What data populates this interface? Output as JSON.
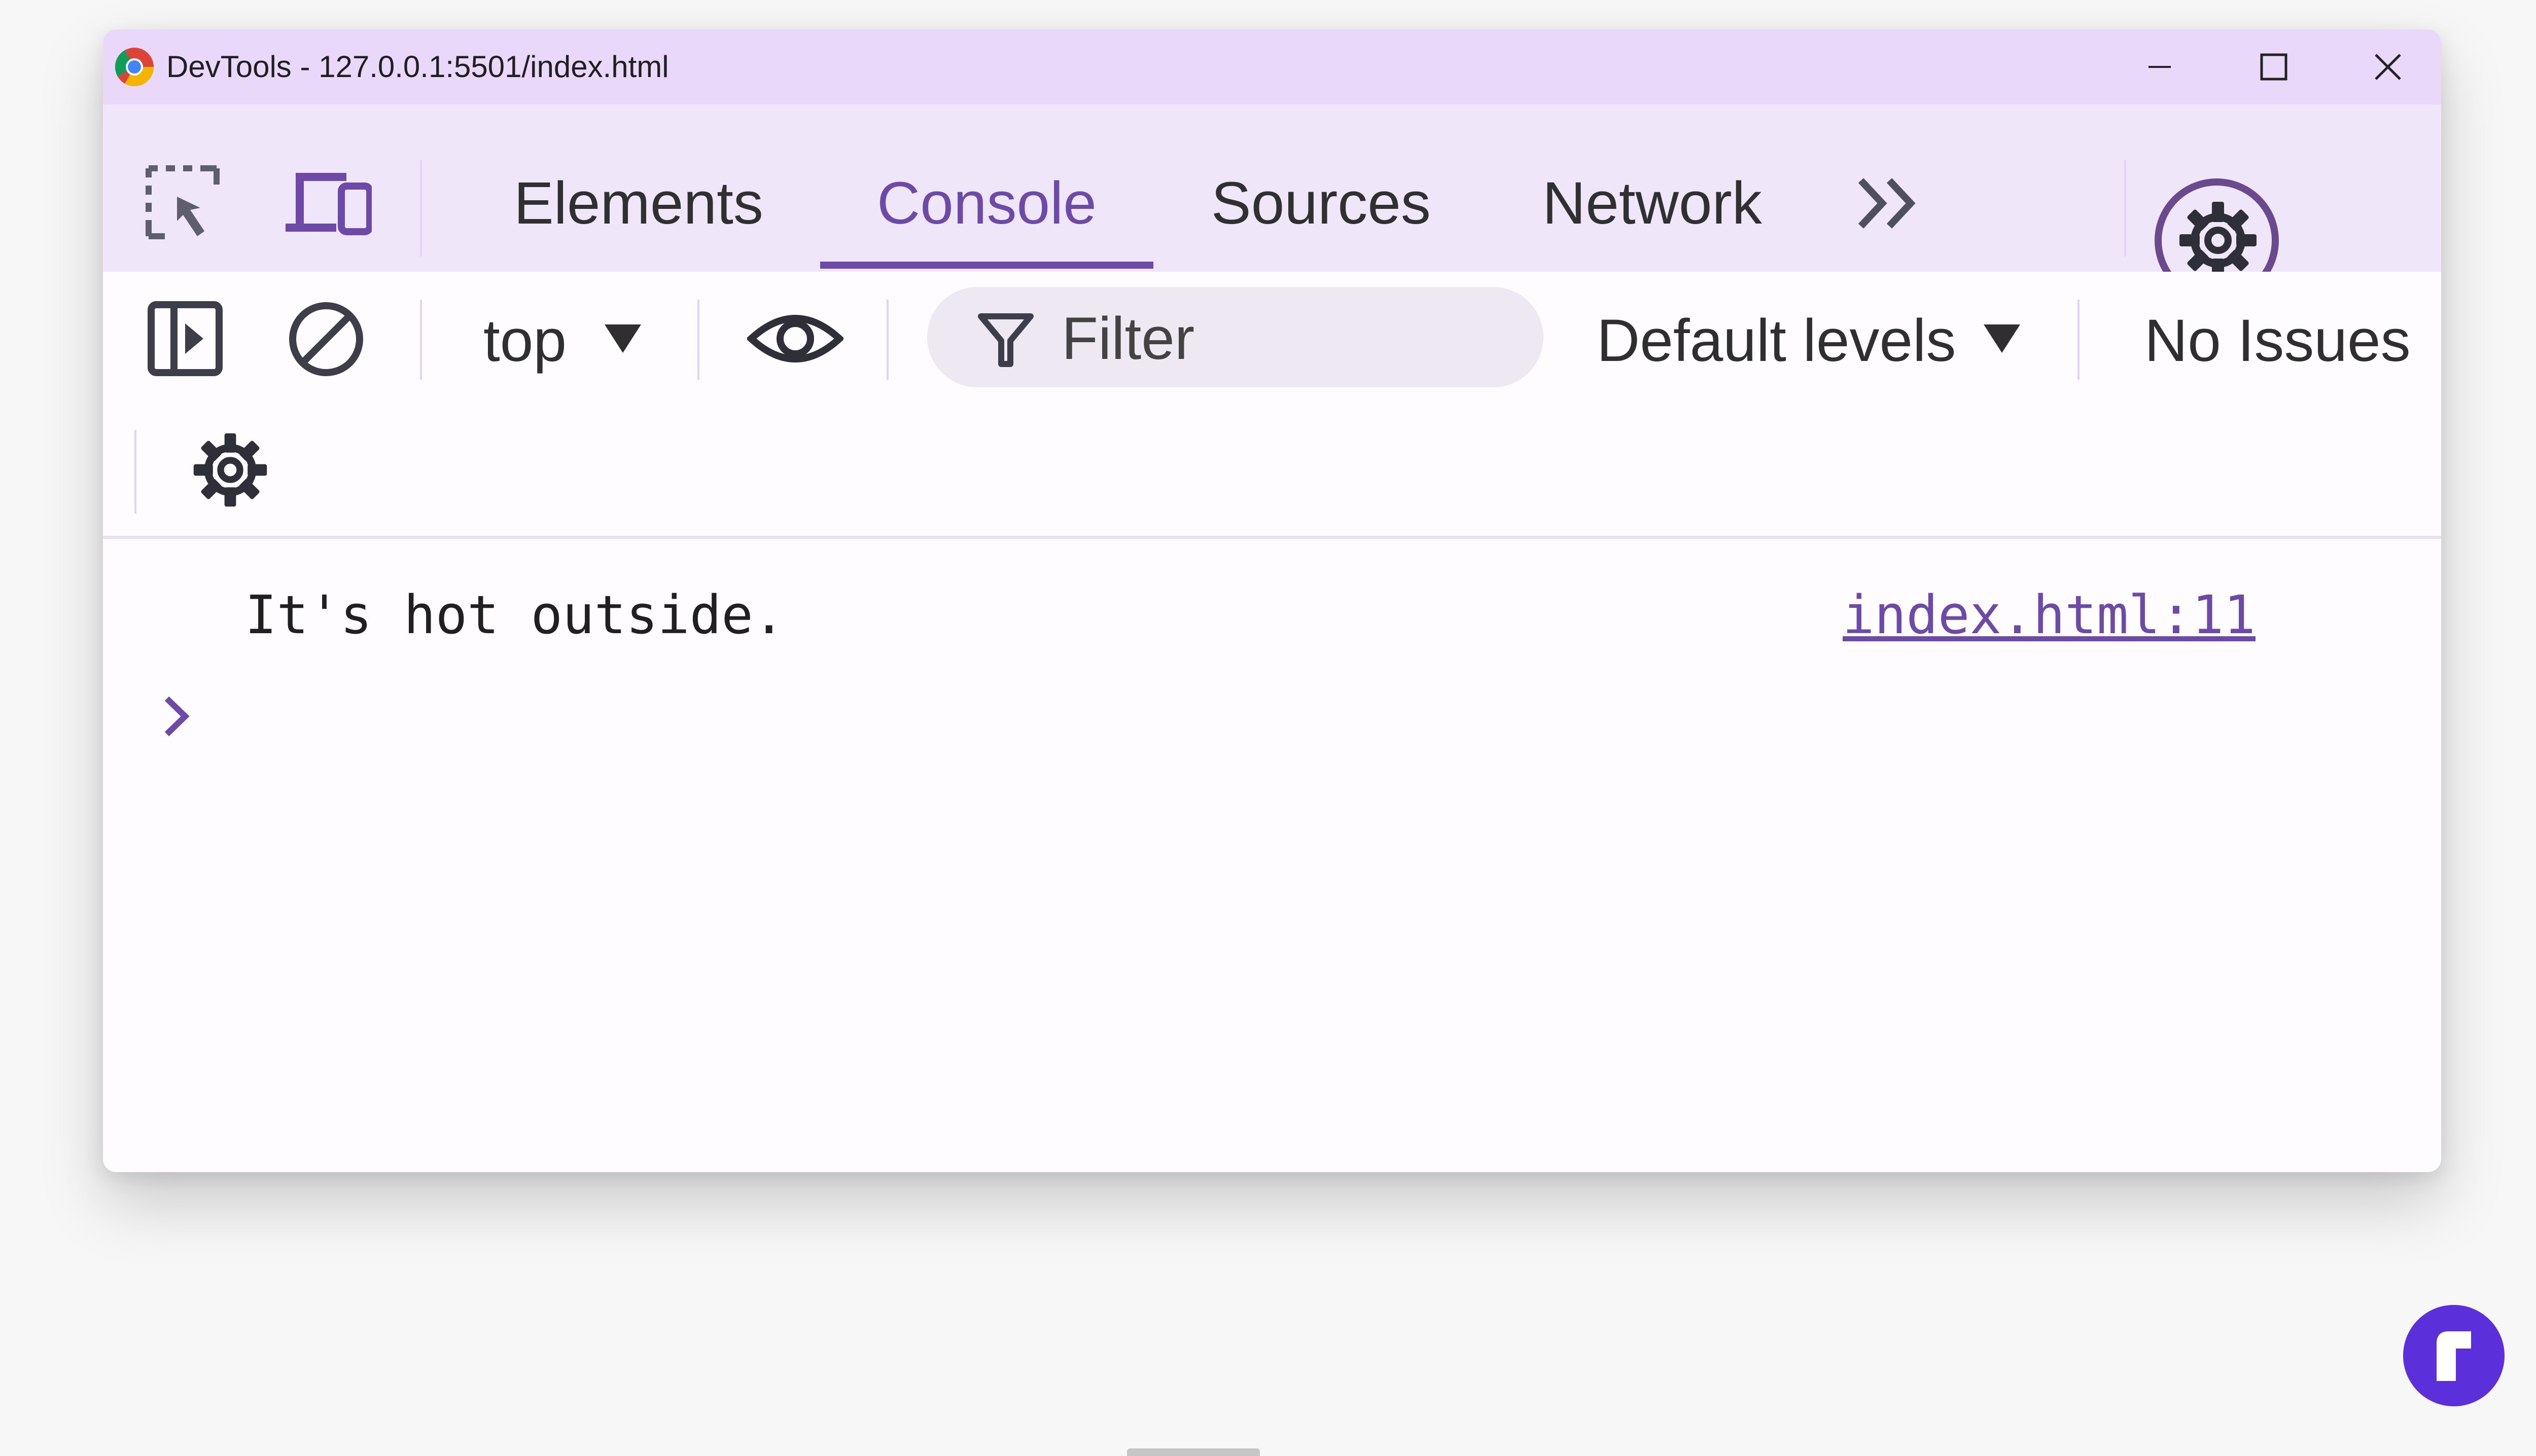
{
  "window": {
    "title": "DevTools - 127.0.0.1:5501/index.html"
  },
  "tabs": [
    {
      "label": "Elements",
      "active": false
    },
    {
      "label": "Console",
      "active": true
    },
    {
      "label": "Sources",
      "active": false
    },
    {
      "label": "Network",
      "active": false
    }
  ],
  "toolbar": {
    "context_selector": "top",
    "filter_placeholder": "Filter",
    "levels_selector": "Default levels",
    "issues": "No Issues"
  },
  "console": {
    "messages": [
      {
        "text": "It's hot outside.",
        "source": "index.html:11"
      }
    ]
  },
  "colors": {
    "titlebar": "#e9d8fa",
    "tabbar": "#f0e6fa",
    "accent": "#6d4aa8",
    "badge": "#5b2fd9"
  },
  "icons": {
    "app": "chrome-icon",
    "inspect": "inspect-element-icon",
    "device": "device-toolbar-icon",
    "more_tabs": "chevron-double-right-icon",
    "settings": "gear-icon",
    "menu": "kebab-menu-icon",
    "sidebar": "sidebar-toggle-icon",
    "clear": "clear-console-icon",
    "live_expression": "eye-icon",
    "filter": "filter-icon",
    "console_settings": "gear-icon",
    "prompt": "chevron-right-icon",
    "brand": "r-badge"
  }
}
